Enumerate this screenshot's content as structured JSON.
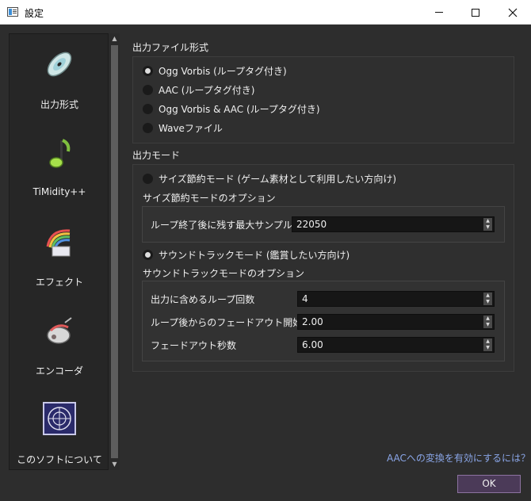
{
  "window": {
    "title": "設定",
    "controls": {
      "minimize": "minimize-icon",
      "maximize": "maximize-icon",
      "close": "close-icon"
    }
  },
  "sidebar": {
    "items": [
      {
        "label": "出力形式",
        "icon": "disc-icon"
      },
      {
        "label": "TiMidity++",
        "icon": "music-note-icon"
      },
      {
        "label": "エフェクト",
        "icon": "rainbow-effect-icon"
      },
      {
        "label": "エンコーダ",
        "icon": "encoder-icon"
      },
      {
        "label": "このソフトについて",
        "icon": "about-emblem-icon"
      }
    ]
  },
  "output_format": {
    "title": "出力ファイル形式",
    "options": [
      {
        "label": "Ogg Vorbis (ループタグ付き)",
        "checked": true
      },
      {
        "label": "AAC (ループタグ付き)",
        "checked": false
      },
      {
        "label": "Ogg Vorbis & AAC (ループタグ付き)",
        "checked": false
      },
      {
        "label": "Waveファイル",
        "checked": false
      }
    ]
  },
  "output_mode": {
    "title": "出力モード",
    "size_saving": {
      "label": "サイズ節約モード (ゲーム素材として利用したい方向け)",
      "checked": false,
      "options_title": "サイズ節約モードのオプション",
      "fields": [
        {
          "label": "ループ終了後に残す最大サンプル数",
          "value": "22050"
        }
      ]
    },
    "soundtrack": {
      "label": "サウンドトラックモード (鑑賞したい方向け)",
      "checked": true,
      "options_title": "サウンドトラックモードのオプション",
      "fields": [
        {
          "label": "出力に含めるループ回数",
          "value": "4"
        },
        {
          "label": "ループ後からのフェードアウト開始秒数",
          "value": "2.00"
        },
        {
          "label": "フェードアウト秒数",
          "value": "6.00"
        }
      ]
    }
  },
  "footer": {
    "help_link": "AACへの変換を有効にするには？",
    "ok_label": "OK"
  },
  "colors": {
    "background": "#2d2d2d",
    "accent_button": "#4b3a58",
    "link": "#8aa6e8"
  }
}
